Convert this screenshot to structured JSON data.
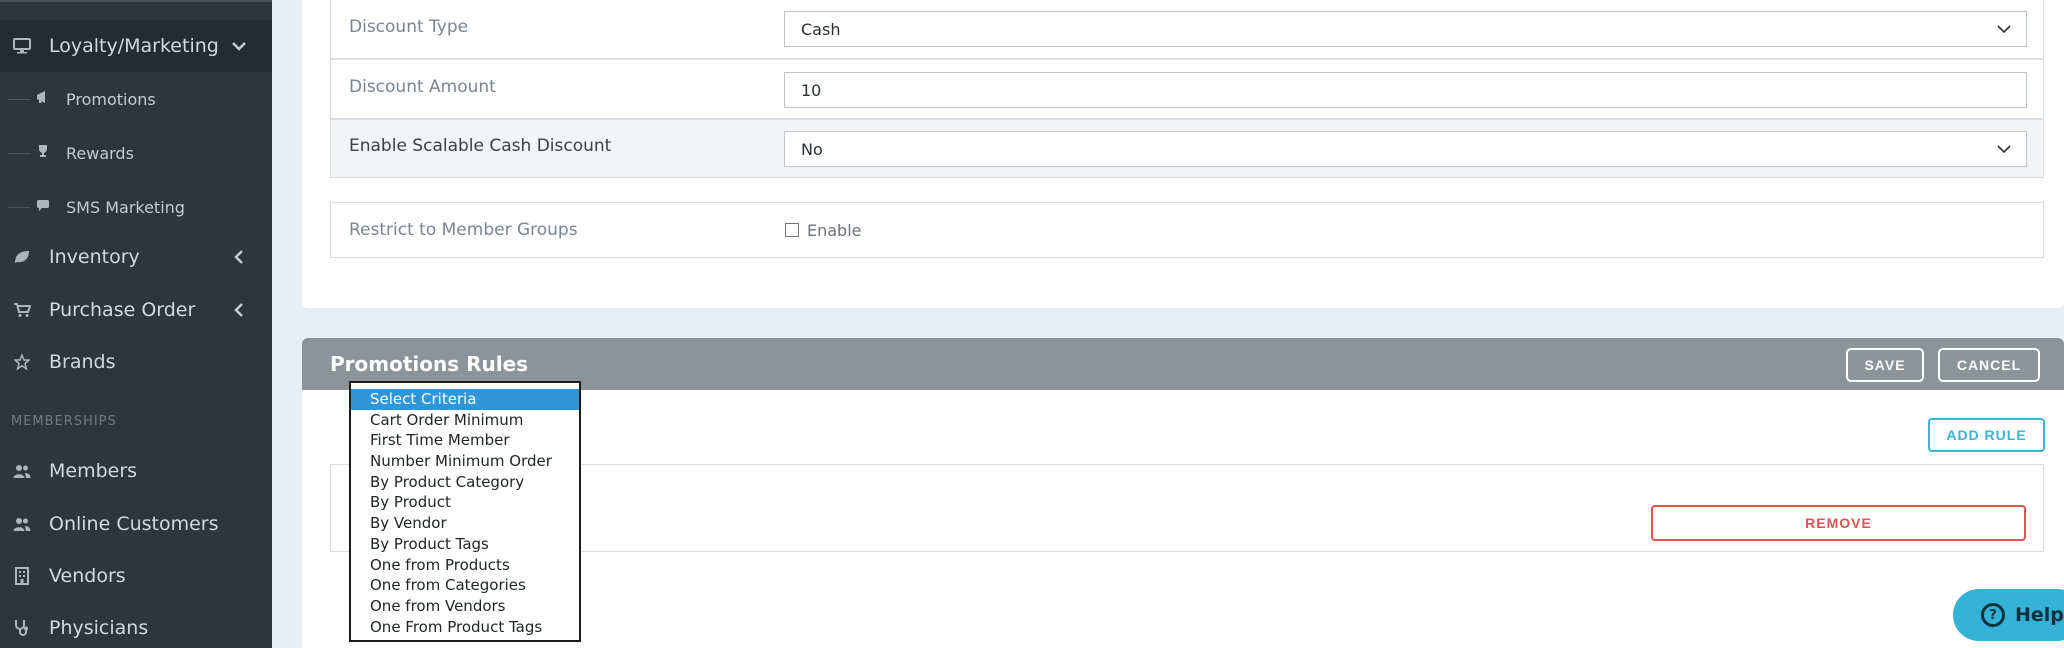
{
  "sidebar": {
    "loyalty": {
      "label": "Loyalty/Marketing",
      "icon": "monitor-icon"
    },
    "sub_items": [
      {
        "label": "Promotions",
        "icon": "megaphone-icon"
      },
      {
        "label": "Rewards",
        "icon": "trophy-icon"
      },
      {
        "label": "SMS Marketing",
        "icon": "comment-icon"
      }
    ],
    "items": [
      {
        "label": "Inventory",
        "icon": "leaf-icon"
      },
      {
        "label": "Purchase Order",
        "icon": "cart-icon"
      },
      {
        "label": "Brands",
        "icon": "star-icon"
      }
    ],
    "section_memberships": "MEMBERSHIPS",
    "member_items": [
      {
        "label": "Members",
        "icon": "users-icon"
      },
      {
        "label": "Online Customers",
        "icon": "users-icon"
      },
      {
        "label": "Vendors",
        "icon": "building-icon"
      },
      {
        "label": "Physicians",
        "icon": "stethoscope-icon"
      }
    ]
  },
  "form": {
    "discount_type": {
      "label": "Discount Type",
      "value": "Cash"
    },
    "discount_amount": {
      "label": "Discount Amount",
      "value": "10"
    },
    "scalable_cash": {
      "label": "Enable Scalable Cash Discount",
      "value": "No"
    },
    "restrict_groups": {
      "label": "Restrict to Member Groups",
      "checkbox_label": "Enable"
    }
  },
  "rules": {
    "title": "Promotions Rules",
    "save_label": "SAVE",
    "cancel_label": "CANCEL",
    "add_rule_label": "ADD RULE",
    "remove_label": "REMOVE",
    "criteria_options": [
      "Select Criteria",
      "Cart Order Minimum",
      "First Time Member",
      "Number Minimum Order",
      "By Product Category",
      "By Product",
      "By Vendor",
      "By Product Tags",
      "One from Products",
      "One from Categories",
      "One from Vendors",
      "One From Product Tags"
    ]
  },
  "help": {
    "label": "Help"
  }
}
